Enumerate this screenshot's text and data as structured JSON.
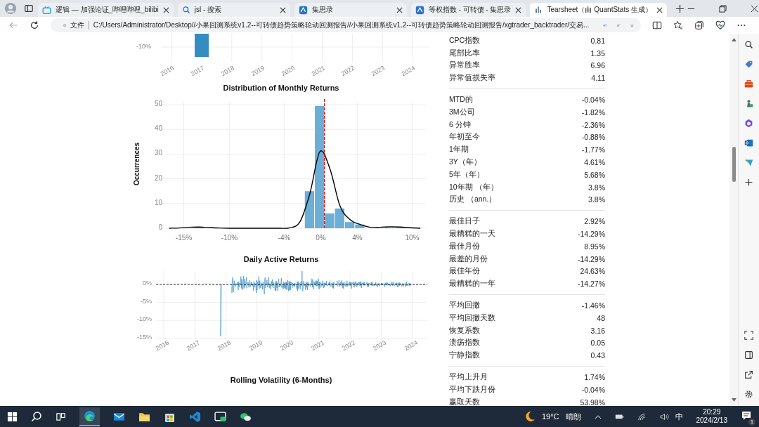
{
  "browser": {
    "tabs": [
      {
        "title": "逻辑 — 加强论证_哔哩哔哩_bilibi",
        "kind": "video",
        "selected": false
      },
      {
        "title": "jsl - 搜索",
        "kind": "search",
        "selected": false
      },
      {
        "title": "集思录",
        "kind": "site",
        "selected": false
      },
      {
        "title": "等权指数 - 可转债 - 集思录",
        "kind": "site",
        "selected": false
      },
      {
        "title": "Tearsheet（由 QuantStats 生成）",
        "kind": "report",
        "selected": true
      }
    ],
    "address": {
      "scheme": "文件",
      "url": "C:/Users/Administrator/Desktop//小果回测系统v1.2--可转债趋势策略轮动回测报告//小果回测系统v1.2--可转债趋势策略轮动回测报告/xgtrader_backtrader/交易..."
    }
  },
  "page": {
    "top_chart": {
      "y_labels": [
        "-10%"
      ],
      "x_labels": [
        "2016",
        "2017",
        "2018",
        "2019",
        "2020",
        "2021",
        "2022",
        "2023",
        "2024"
      ]
    },
    "distribution": {
      "chart_data": {
        "type": "bar",
        "title": "Distribution of Monthly Returns",
        "ylabel": "Occurrences",
        "x": [
          -16.6,
          -15.5,
          -14.4,
          -13.3,
          -12.2,
          -11.1,
          -10.0,
          -8.9,
          -7.8,
          -6.7,
          -5.6,
          -4.5,
          -3.4,
          -2.3,
          -1.2,
          -0.1,
          1.0,
          2.1,
          3.2,
          4.3,
          5.4,
          6.5,
          7.6,
          8.7,
          9.8,
          10.9
        ],
        "series": [
          {
            "type": "bar",
            "color": "#6baed6",
            "values": [
              null,
              null,
              null,
              0.5,
              null,
              null,
              null,
              null,
              null,
              null,
              null,
              null,
              null,
              null,
              15,
              49.5,
              6,
              8,
              2.5,
              1.5,
              null,
              null,
              0.4,
              0.4,
              null,
              null
            ]
          },
          {
            "type": "line",
            "color": "#000000",
            "values": [
              0,
              0.1,
              0.4,
              0.5,
              0.3,
              0.1,
              0,
              0,
              0,
              0,
              0,
              0,
              0.2,
              2.5,
              14,
              31,
              24,
              9,
              3.5,
              1.5,
              0.4,
              0.4,
              0.6,
              0.5,
              0.2,
              0
            ]
          }
        ],
        "xlim": [
          -17.5,
          11.5
        ],
        "ylim": [
          0,
          52
        ],
        "yticks": [
          0,
          10,
          20,
          30,
          40,
          50
        ],
        "xticks": [
          {
            "value": -15,
            "label": "-15%"
          },
          {
            "value": -10,
            "label": "-10%"
          },
          {
            "value": -4,
            "label": "-4%"
          },
          {
            "value": 0,
            "label": "0%"
          },
          {
            "value": 4,
            "label": "4%"
          },
          {
            "value": 10,
            "label": "10%"
          }
        ],
        "grid": true,
        "ref_lines": [
          {
            "axis": "x",
            "value": 0.4,
            "color": "#cc0000"
          }
        ]
      }
    },
    "daily": {
      "title": "Daily Active Returns",
      "y_labels": [
        "0%",
        "-5%",
        "-10%",
        "-15%"
      ],
      "x_labels": [
        "2016",
        "2017",
        "2018",
        "2019",
        "2020",
        "2021",
        "2022",
        "2023",
        "2024"
      ]
    },
    "next_title": "Rolling Volatility (6-Months)",
    "metrics": [
      {
        "rows": [
          {
            "label": "CPC指数",
            "value": "0.81"
          },
          {
            "label": "尾部比率",
            "value": "1.35"
          },
          {
            "label": "异常胜率",
            "value": "6.96"
          },
          {
            "label": "异常值损失率",
            "value": "4.11"
          }
        ]
      },
      {
        "rows": [
          {
            "label": "MTD的",
            "value": "-0.04%"
          },
          {
            "label": "3M公司",
            "value": "-1.82%"
          },
          {
            "label": "6 分钟",
            "value": "-2.36%"
          },
          {
            "label": "年初至今",
            "value": "-0.88%"
          },
          {
            "label": "1年期",
            "value": "-1.77%"
          },
          {
            "label": "3Y（年）",
            "value": "4.61%"
          },
          {
            "label": "5年（年）",
            "value": "5.68%"
          },
          {
            "label": "10年期 （年）",
            "value": "3.8%"
          },
          {
            "label": "历史 （ann.）",
            "value": "3.8%"
          }
        ]
      },
      {
        "rows": [
          {
            "label": "最佳日子",
            "value": "2.92%"
          },
          {
            "label": "最糟糕的一天",
            "value": "-14.29%"
          },
          {
            "label": "最佳月份",
            "value": "8.95%"
          },
          {
            "label": "最差的月份",
            "value": "-14.29%"
          },
          {
            "label": "最佳年份",
            "value": "24.63%"
          },
          {
            "label": "最糟糕的一年",
            "value": "-14.27%"
          }
        ]
      },
      {
        "rows": [
          {
            "label": "平均回撤",
            "value": "-1.46%"
          },
          {
            "label": "平均回撤天数",
            "value": "48"
          },
          {
            "label": "恢复系数",
            "value": "3.16"
          },
          {
            "label": "溃疡指数",
            "value": "0.05"
          },
          {
            "label": "宁静指数",
            "value": "0.43"
          }
        ]
      },
      {
        "rows": [
          {
            "label": "平均上升月",
            "value": "1.74%"
          },
          {
            "label": "平均下跌月份",
            "value": "-0.04%"
          },
          {
            "label": "赢取天数",
            "value": "53.98%"
          }
        ]
      }
    ]
  },
  "taskbar": {
    "weather": {
      "temperature": "19°C",
      "condition": "晴朗"
    },
    "ime": "中",
    "time": "20:29",
    "date": "2024/2/13",
    "notifications": "1"
  }
}
